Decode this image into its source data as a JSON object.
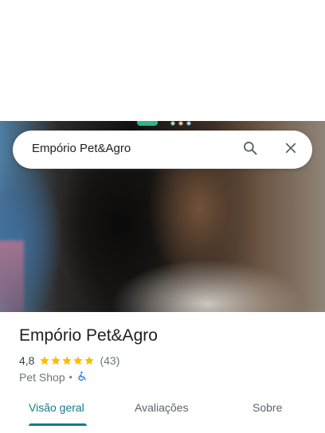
{
  "search": {
    "query": "Empório Pet&Agro",
    "search_icon": "search-icon",
    "close_icon": "close-icon"
  },
  "place": {
    "name": "Empório Pet&Agro",
    "rating": "4,8",
    "stars": 5,
    "review_count": "(43)",
    "category": "Pet Shop",
    "separator": "•",
    "accessibility_icon": "wheelchair-icon"
  },
  "tabs": [
    {
      "label": "Visão geral",
      "active": true
    },
    {
      "label": "Avaliações",
      "active": false
    },
    {
      "label": "Sobre",
      "active": false
    }
  ],
  "colors": {
    "accent": "#137b8a",
    "star": "#fbbc04",
    "accessibility": "#1a73e8"
  }
}
